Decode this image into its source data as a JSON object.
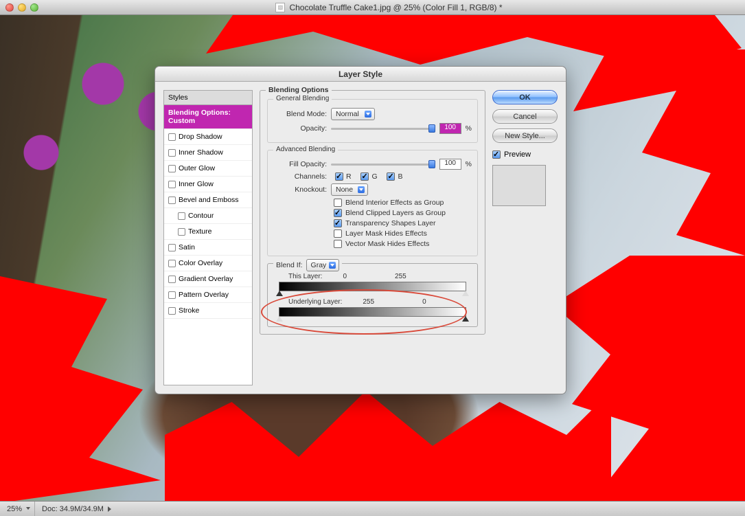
{
  "window": {
    "title": "Chocolate Truffle Cake1.jpg @ 25% (Color Fill 1, RGB/8) *"
  },
  "status": {
    "zoom": "25%",
    "doc": "Doc: 34.9M/34.9M"
  },
  "dialog": {
    "title": "Layer Style",
    "sidebar_header": "Styles",
    "styles": {
      "blending_custom": "Blending Options: Custom",
      "drop_shadow": "Drop Shadow",
      "inner_shadow": "Inner Shadow",
      "outer_glow": "Outer Glow",
      "inner_glow": "Inner Glow",
      "bevel": "Bevel and Emboss",
      "contour": "Contour",
      "texture": "Texture",
      "satin": "Satin",
      "color_overlay": "Color Overlay",
      "gradient_overlay": "Gradient Overlay",
      "pattern_overlay": "Pattern Overlay",
      "stroke": "Stroke"
    },
    "sections": {
      "blending_options": "Blending Options",
      "general": "General Blending",
      "advanced": "Advanced Blending",
      "blend_if": "Blend If:"
    },
    "labels": {
      "blend_mode": "Blend Mode:",
      "opacity": "Opacity:",
      "fill_opacity": "Fill Opacity:",
      "channels": "Channels:",
      "knockout": "Knockout:",
      "blend_interior": "Blend Interior Effects as Group",
      "blend_clipped": "Blend Clipped Layers as Group",
      "transparency_shapes": "Transparency Shapes Layer",
      "layer_mask_hides": "Layer Mask Hides Effects",
      "vector_mask_hides": "Vector Mask Hides Effects",
      "this_layer": "This Layer:",
      "underlying": "Underlying Layer:",
      "percent": "%",
      "r": "R",
      "g": "G",
      "b": "B"
    },
    "values": {
      "blend_mode": "Normal",
      "opacity": "100",
      "fill_opacity": "100",
      "knockout": "None",
      "blendif_channel": "Gray",
      "this_low": "0",
      "this_high": "255",
      "under_low": "255",
      "under_high": "0"
    },
    "buttons": {
      "ok": "OK",
      "cancel": "Cancel",
      "new_style": "New Style...",
      "preview": "Preview"
    }
  }
}
